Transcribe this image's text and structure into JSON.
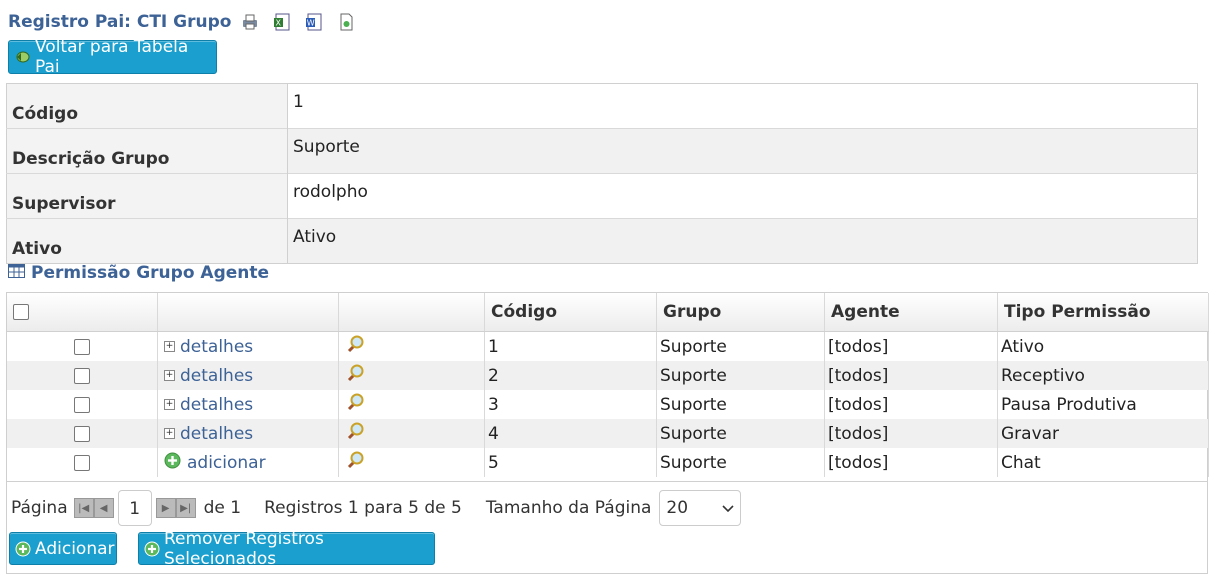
{
  "header": {
    "title": "Registro Pai: CTI Grupo",
    "icons": [
      "print-icon",
      "excel-icon",
      "word-icon",
      "export-icon"
    ]
  },
  "back_button": {
    "label": "Voltar para Tabela Pai"
  },
  "detail": {
    "rows": [
      {
        "label": "Código",
        "value": "1"
      },
      {
        "label": "Descrição Grupo",
        "value": "Suporte"
      },
      {
        "label": "Supervisor",
        "value": "rodolpho"
      },
      {
        "label": "Ativo",
        "value": "Ativo"
      }
    ]
  },
  "section": {
    "title": "Permissão Grupo Agente"
  },
  "grid": {
    "columns": [
      "",
      "",
      "",
      "Código",
      "Grupo",
      "Agente",
      "Tipo Permissão"
    ],
    "rows": [
      {
        "link": "detalhes",
        "codigo": "1",
        "grupo": "Suporte",
        "agente": "[todos]",
        "tipo": "Ativo"
      },
      {
        "link": "detalhes",
        "codigo": "2",
        "grupo": "Suporte",
        "agente": "[todos]",
        "tipo": "Receptivo"
      },
      {
        "link": "detalhes",
        "codigo": "3",
        "grupo": "Suporte",
        "agente": "[todos]",
        "tipo": "Pausa Produtiva"
      },
      {
        "link": "detalhes",
        "codigo": "4",
        "grupo": "Suporte",
        "agente": "[todos]",
        "tipo": "Gravar"
      },
      {
        "link": "adicionar",
        "codigo": "5",
        "grupo": "Suporte",
        "agente": "[todos]",
        "tipo": "Chat"
      }
    ]
  },
  "pager": {
    "page_label": "Página",
    "page_value": "1",
    "of_label": "de 1",
    "records_label": "Registros 1 para 5 de 5",
    "size_label": "Tamanho da Página",
    "size_value": "20"
  },
  "actions": {
    "add_label": "Adicionar",
    "remove_label": "Remover Registros Selecionados"
  },
  "colors": {
    "accent": "#1a9fce",
    "title": "#3d6296",
    "add_icon": "#4caf50"
  }
}
